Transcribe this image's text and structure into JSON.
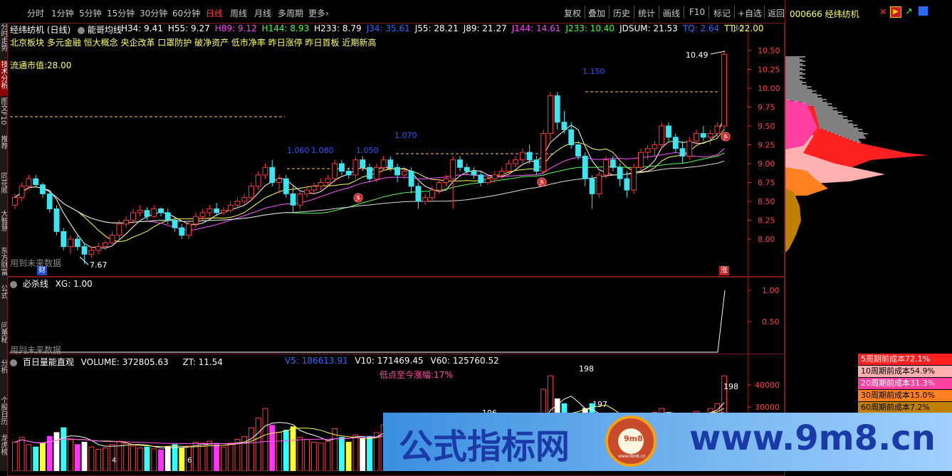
{
  "toolbar": {
    "periods": [
      "分时",
      "1分钟",
      "5分钟",
      "15分钟",
      "30分钟",
      "60分钟",
      "日线",
      "周线",
      "月线",
      "多周期",
      "更多"
    ],
    "active_period": "日线",
    "more_arrow": "›",
    "right": [
      "复权",
      "叠加",
      "历史",
      "统计",
      "画线",
      "F10",
      "标记",
      "+自选",
      "返回"
    ]
  },
  "left_tabs": [
    "分时走势",
    "技术分析",
    "图文F10",
    "推荐",
    "同花顺",
    "大智慧",
    "东方财富",
    "公式",
    "问董秘",
    "分析",
    "个股日历",
    "龙虎榜"
  ],
  "stock": {
    "code": "000666",
    "name": "经纬纺机"
  },
  "main_panel": {
    "title": "经纬纺机 (日线)",
    "indicator_name": "能哥均线",
    "values": [
      {
        "label": "H34: 9.41",
        "color": "#ffffff"
      },
      {
        "label": "H55: 9.27",
        "color": "#ffffff"
      },
      {
        "label": "H89: 9.12",
        "color": "#ff44ff"
      },
      {
        "label": "H144: 8.93",
        "color": "#44ff44"
      },
      {
        "label": "H233: 8.79",
        "color": "#ffffff"
      },
      {
        "label": "J34: 35.61",
        "color": "#2a6bff"
      },
      {
        "label": "J55: 28.21",
        "color": "#ffffff"
      },
      {
        "label": "J89: 21.27",
        "color": "#ffffff"
      },
      {
        "label": "J144: 14.61",
        "color": "#ff44ff"
      },
      {
        "label": "J233: 10.40",
        "color": "#44ff44"
      },
      {
        "label": "JDSUM: 21.53",
        "color": "#ffffff"
      },
      {
        "label": "TQ: 2.64",
        "color": "#2a6bff"
      },
      {
        "label": "TT: 22.00",
        "color": "#ffff44"
      }
    ],
    "more": "JI",
    "more_icon": "◇",
    "concepts": "北京板块 多元金融 恒大概念 央企改革 口罩防护 破净资产 低市净率 昨日涨停 昨日首板 近期新高",
    "float_cap": "流通市值:28.00",
    "future_note": "用到未来数据",
    "badge_cai": "财",
    "badge_zhang": "涨",
    "badge_duo": "多",
    "annotations": [
      "1.060",
      "1.080",
      "1.050",
      "1.070",
      "1.150",
      "10.49",
      "7.67"
    ],
    "y_axis": [
      "10.50",
      "10.25",
      "10.00",
      "9.75",
      "9.50",
      "9.25",
      "9.00",
      "8.75",
      "8.50",
      "8.25",
      "8.00"
    ]
  },
  "sub1": {
    "title": "必杀线",
    "value": "XG: 1.00",
    "note": "用到未来数据",
    "y_axis": [
      "1.00",
      "0.50"
    ]
  },
  "sub2": {
    "title": "百日量能直观",
    "volume": "VOLUME: 372805.63",
    "zt": "ZT: 11.54",
    "v5": "V5: 186613.91",
    "v10": "V10: 171469.45",
    "v60": "V60: 125760.52",
    "rise_note": "低点至今涨幅:17%",
    "peaks": [
      "198",
      "197",
      "196",
      "198"
    ],
    "small_marks": [
      "4",
      "6"
    ],
    "y_axis": [
      "40000",
      "30000"
    ]
  },
  "cost_table": [
    {
      "label": "5周期前成本72.1%",
      "bg": "#ff2020",
      "fg": "#ffffff"
    },
    {
      "label": "10周期前成本54.9%",
      "bg": "#ffb0b0",
      "fg": "#000000"
    },
    {
      "label": "20周期前成本31.3%",
      "bg": "#ff40a0",
      "fg": "#ffffff"
    },
    {
      "label": "30周期前成本15.0%",
      "bg": "#ff8020",
      "fg": "#000000"
    },
    {
      "label": "60周期前成本7.2%",
      "bg": "#c08000",
      "fg": "#000000"
    }
  ],
  "watermark": {
    "cn": "公式指标网",
    "url": "www.9m8.cn",
    "logo_text": "9m8",
    "logo_sub": "www.9m8.cn"
  },
  "icons": [
    "close-icon",
    "flag-icon",
    "play-icon",
    "chart-icon",
    "grid-icon"
  ],
  "chart_data": {
    "type": "candlestick",
    "title": "经纬纺机 (日线)",
    "ylim": [
      7.6,
      10.6
    ],
    "ohlc": [
      [
        8.45,
        8.6,
        8.4,
        8.55
      ],
      [
        8.55,
        8.75,
        8.5,
        8.7
      ],
      [
        8.7,
        8.85,
        8.65,
        8.8
      ],
      [
        8.8,
        8.85,
        8.7,
        8.72
      ],
      [
        8.72,
        8.75,
        8.55,
        8.6
      ],
      [
        8.6,
        8.65,
        8.35,
        8.4
      ],
      [
        8.4,
        8.45,
        8.05,
        8.1
      ],
      [
        8.1,
        8.15,
        7.85,
        7.9
      ],
      [
        7.9,
        8.05,
        7.8,
        8.0
      ],
      [
        8.0,
        8.05,
        7.85,
        7.9
      ],
      [
        7.9,
        7.95,
        7.67,
        7.8
      ],
      [
        7.8,
        7.9,
        7.75,
        7.85
      ],
      [
        7.85,
        7.95,
        7.8,
        7.9
      ],
      [
        7.9,
        7.98,
        7.85,
        7.95
      ],
      [
        7.95,
        8.1,
        7.9,
        8.05
      ],
      [
        8.05,
        8.25,
        8.0,
        8.2
      ],
      [
        8.2,
        8.3,
        8.15,
        8.25
      ],
      [
        8.25,
        8.4,
        8.2,
        8.35
      ],
      [
        8.35,
        8.45,
        8.3,
        8.38
      ],
      [
        8.38,
        8.42,
        8.25,
        8.3
      ],
      [
        8.3,
        8.45,
        8.28,
        8.4
      ],
      [
        8.4,
        8.42,
        8.3,
        8.35
      ],
      [
        8.35,
        8.4,
        8.2,
        8.25
      ],
      [
        8.25,
        8.3,
        8.1,
        8.15
      ],
      [
        8.15,
        8.2,
        8.0,
        8.05
      ],
      [
        8.05,
        8.25,
        8.0,
        8.2
      ],
      [
        8.2,
        8.35,
        8.15,
        8.3
      ],
      [
        8.3,
        8.4,
        8.25,
        8.35
      ],
      [
        8.35,
        8.45,
        8.3,
        8.4
      ],
      [
        8.4,
        8.48,
        8.3,
        8.35
      ],
      [
        8.35,
        8.42,
        8.32,
        8.38
      ],
      [
        8.38,
        8.5,
        8.35,
        8.45
      ],
      [
        8.45,
        8.55,
        8.4,
        8.5
      ],
      [
        8.5,
        8.6,
        8.45,
        8.55
      ],
      [
        8.55,
        8.75,
        8.5,
        8.7
      ],
      [
        8.7,
        8.9,
        8.65,
        8.85
      ],
      [
        8.85,
        9.0,
        8.8,
        8.95
      ],
      [
        8.95,
        9.05,
        8.7,
        8.75
      ],
      [
        8.75,
        8.85,
        8.6,
        8.8
      ],
      [
        8.8,
        8.85,
        8.55,
        8.6
      ],
      [
        8.6,
        8.7,
        8.35,
        8.45
      ],
      [
        8.45,
        8.65,
        8.4,
        8.6
      ],
      [
        8.6,
        8.7,
        8.55,
        8.65
      ],
      [
        8.65,
        8.75,
        8.6,
        8.7
      ],
      [
        8.7,
        8.8,
        8.65,
        8.75
      ],
      [
        8.75,
        8.85,
        8.7,
        8.8
      ],
      [
        8.8,
        9.05,
        8.75,
        9.0
      ],
      [
        9.0,
        9.05,
        8.85,
        8.9
      ],
      [
        8.9,
        8.95,
        8.8,
        8.85
      ],
      [
        8.85,
        9.1,
        8.8,
        9.05
      ],
      [
        9.05,
        9.1,
        8.9,
        8.95
      ],
      [
        8.95,
        9.0,
        8.75,
        8.8
      ],
      [
        8.8,
        9.0,
        8.75,
        8.95
      ],
      [
        8.95,
        9.1,
        8.9,
        9.05
      ],
      [
        9.05,
        9.1,
        8.9,
        8.95
      ],
      [
        8.95,
        9.0,
        8.75,
        8.85
      ],
      [
        8.85,
        8.95,
        8.8,
        8.9
      ],
      [
        8.9,
        8.95,
        8.6,
        8.7
      ],
      [
        8.7,
        8.75,
        8.4,
        8.5
      ],
      [
        8.5,
        8.6,
        8.45,
        8.55
      ],
      [
        8.55,
        8.7,
        8.5,
        8.65
      ],
      [
        8.65,
        8.8,
        8.6,
        8.75
      ],
      [
        8.75,
        8.85,
        8.7,
        8.8
      ],
      [
        8.8,
        9.1,
        8.4,
        9.05
      ],
      [
        9.05,
        9.1,
        8.9,
        8.95
      ],
      [
        8.95,
        9.0,
        8.85,
        8.9
      ],
      [
        8.9,
        8.95,
        8.8,
        8.85
      ],
      [
        8.85,
        8.9,
        8.7,
        8.75
      ],
      [
        8.75,
        8.85,
        8.72,
        8.8
      ],
      [
        8.8,
        8.9,
        8.75,
        8.85
      ],
      [
        8.85,
        8.95,
        8.8,
        8.9
      ],
      [
        8.9,
        9.05,
        8.85,
        9.0
      ],
      [
        9.0,
        9.1,
        8.95,
        9.05
      ],
      [
        9.05,
        9.2,
        9.0,
        9.15
      ],
      [
        9.15,
        9.25,
        9.0,
        9.05
      ],
      [
        9.05,
        9.1,
        8.85,
        8.9
      ],
      [
        8.9,
        9.45,
        8.85,
        9.4
      ],
      [
        9.4,
        9.95,
        9.3,
        9.9
      ],
      [
        9.9,
        9.95,
        9.45,
        9.55
      ],
      [
        9.55,
        9.7,
        9.4,
        9.45
      ],
      [
        9.45,
        9.55,
        9.2,
        9.25
      ],
      [
        9.25,
        9.3,
        9.05,
        9.1
      ],
      [
        9.1,
        9.15,
        8.7,
        8.8
      ],
      [
        8.8,
        8.85,
        8.4,
        8.6
      ],
      [
        8.6,
        8.9,
        8.55,
        8.85
      ],
      [
        8.85,
        9.1,
        8.8,
        9.05
      ],
      [
        9.05,
        9.1,
        8.9,
        8.95
      ],
      [
        8.95,
        9.0,
        8.7,
        8.8
      ],
      [
        8.8,
        8.9,
        8.55,
        8.65
      ],
      [
        8.65,
        9.0,
        8.6,
        8.95
      ],
      [
        8.95,
        9.2,
        8.9,
        9.15
      ],
      [
        9.15,
        9.25,
        9.05,
        9.2
      ],
      [
        9.2,
        9.3,
        9.1,
        9.25
      ],
      [
        9.25,
        9.55,
        9.2,
        9.5
      ],
      [
        9.5,
        9.55,
        9.3,
        9.35
      ],
      [
        9.35,
        9.4,
        9.15,
        9.2
      ],
      [
        9.2,
        9.3,
        9.0,
        9.1
      ],
      [
        9.1,
        9.35,
        9.05,
        9.3
      ],
      [
        9.3,
        9.45,
        9.25,
        9.4
      ],
      [
        9.4,
        9.5,
        9.3,
        9.35
      ],
      [
        9.35,
        9.45,
        9.25,
        9.4
      ],
      [
        9.4,
        9.55,
        9.35,
        9.5
      ],
      [
        9.5,
        10.49,
        9.45,
        10.45
      ]
    ],
    "volume": [
      60,
      70,
      55,
      50,
      58,
      72,
      80,
      90,
      65,
      55,
      60,
      50,
      45,
      48,
      55,
      62,
      58,
      52,
      48,
      50,
      46,
      44,
      50,
      55,
      48,
      52,
      60,
      58,
      62,
      55,
      50,
      58,
      66,
      72,
      90,
      110,
      130,
      95,
      80,
      85,
      92,
      70,
      66,
      60,
      58,
      62,
      88,
      70,
      60,
      75,
      68,
      72,
      80,
      96,
      84,
      70,
      66,
      88,
      94,
      70,
      62,
      70,
      75,
      100,
      86,
      70,
      65,
      70,
      62,
      66,
      70,
      78,
      84,
      92,
      80,
      90,
      170,
      198,
      150,
      140,
      120,
      110,
      130,
      140,
      100,
      110,
      95,
      90,
      100,
      110,
      120,
      118,
      122,
      130,
      120,
      110,
      115,
      120,
      124,
      118,
      130,
      140,
      198
    ],
    "cost_profile_legend": [
      "5周期前成本72.1%",
      "10周期前成本54.9%",
      "20周期前成本31.3%",
      "30周期前成本15.0%",
      "60周期前成本7.2%"
    ]
  }
}
